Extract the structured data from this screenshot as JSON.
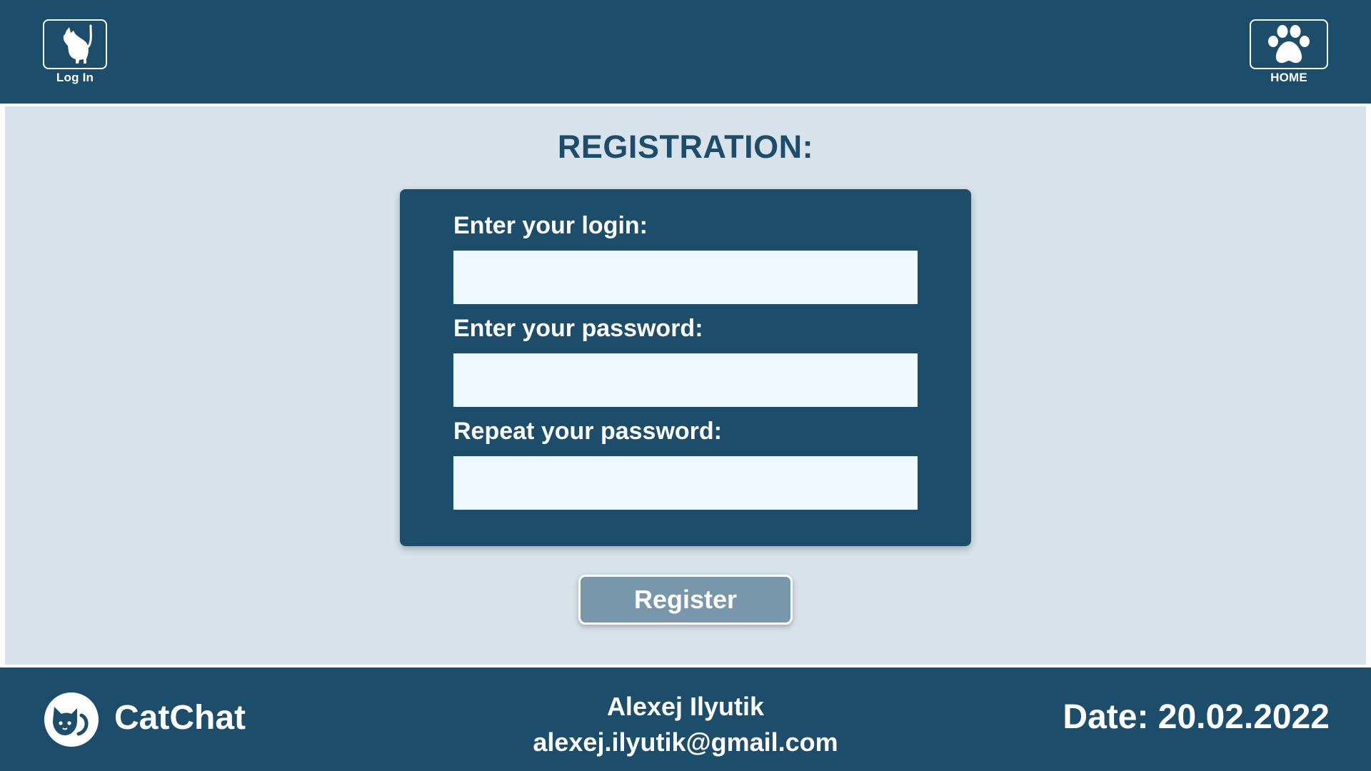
{
  "header": {
    "login": {
      "label": "Log In",
      "icon": "cat-icon"
    },
    "home": {
      "label": "HOME",
      "icon": "paw-icon"
    }
  },
  "registration": {
    "title": "REGISTRATION:",
    "fields": [
      {
        "label": "Enter your login:",
        "value": "",
        "placeholder": ""
      },
      {
        "label": "Enter your password:",
        "value": "",
        "placeholder": ""
      },
      {
        "label": "Repeat your password:",
        "value": "",
        "placeholder": ""
      }
    ],
    "submit_label": "Register"
  },
  "footer": {
    "brand": "CatChat",
    "author_name": "Alexej Ilyutik",
    "author_email": "alexej.ilyutik@gmail.com",
    "date_text": "Date: 20.02.2022"
  },
  "colors": {
    "primary": "#1c4e6c",
    "background": "#d7e2ea",
    "input_bg": "#eff7ff",
    "button": "#7897ab"
  }
}
